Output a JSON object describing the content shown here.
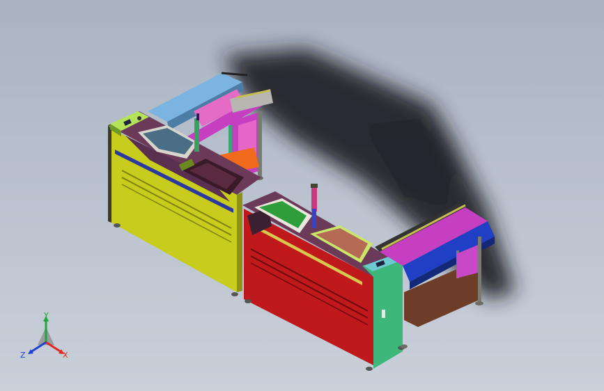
{
  "view": {
    "background_top": "#a9b3c2",
    "background_bottom": "#c9d0da"
  },
  "model": {
    "colors": {
      "yellow_cabinet": "#c8cc1c",
      "red_cabinet": "#c0191c",
      "green_panel": "#3db87a",
      "light_blue_rail": "#7bb4e0",
      "blue_rail": "#1f3fc4",
      "purple_top": "#6b3a58",
      "magenta": "#c53fc0",
      "orange_tray": "#f26a1c",
      "green_tray": "#2e9e3a",
      "brown_tray": "#b46a54",
      "slate_window": "#4a6e86",
      "lime_panel": "#b4e35a",
      "brown_shelf": "#6e3d2a"
    }
  },
  "triad": {
    "x_label": "X",
    "y_label": "Y",
    "z_label": "Z",
    "x_color": "#e0261e",
    "y_color": "#1fa83a",
    "z_color": "#2040d0"
  }
}
